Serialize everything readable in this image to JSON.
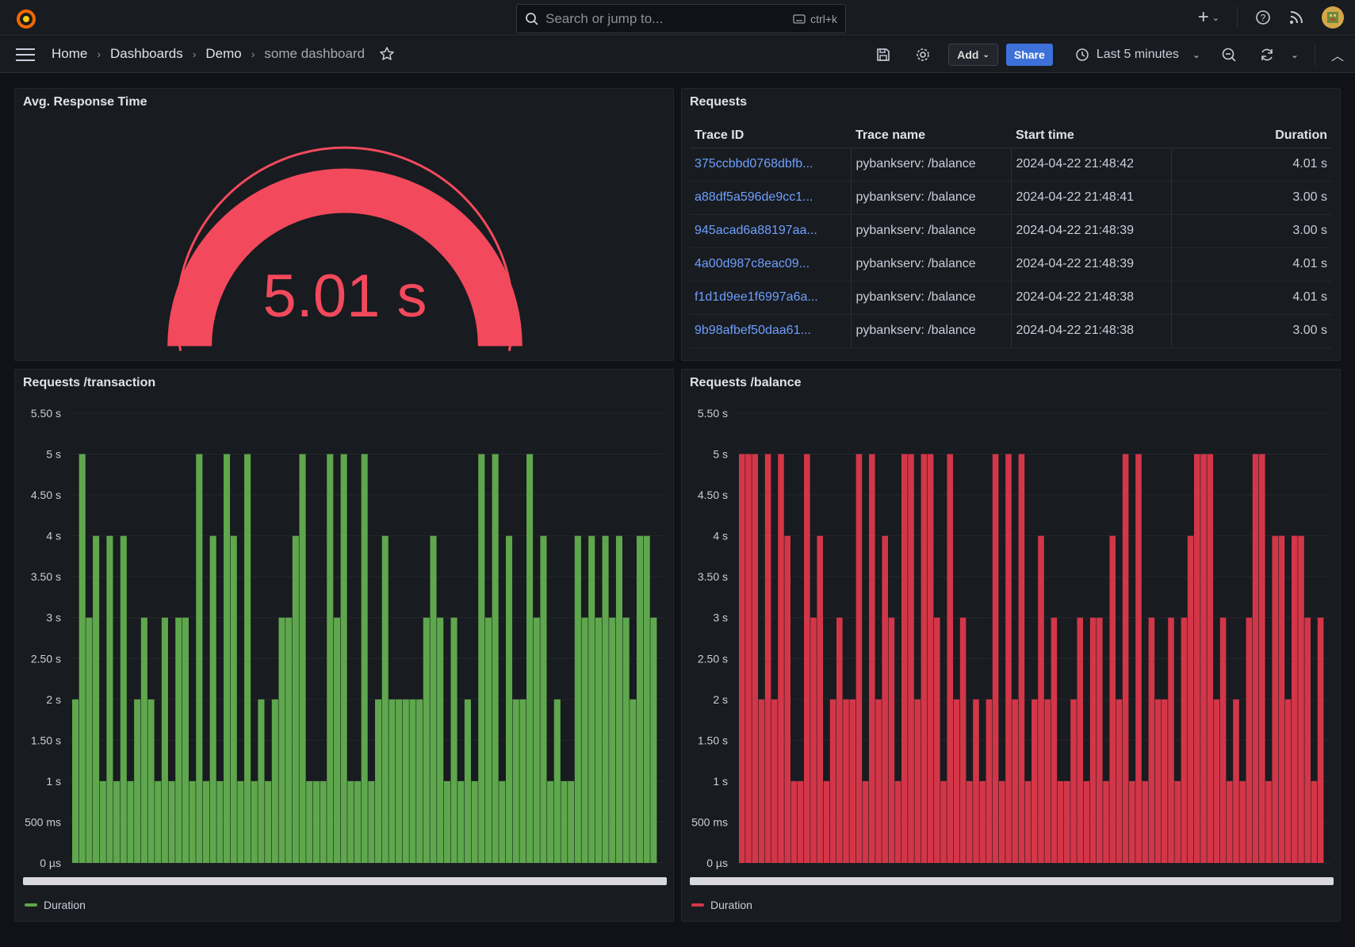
{
  "topbar": {
    "search_placeholder": "Search or jump to...",
    "search_shortcut": "ctrl+k",
    "icons": [
      "grafana-logo-icon",
      "plus-icon",
      "help-icon",
      "news-icon",
      "avatar"
    ]
  },
  "navbar": {
    "breadcrumbs": [
      "Home",
      "Dashboards",
      "Demo",
      "some dashboard"
    ],
    "add_label": "Add",
    "share_label": "Share",
    "time_range": "Last 5 minutes"
  },
  "colors": {
    "green": "#5fa74d",
    "red": "#d33648",
    "gauge": "#f2495c",
    "link": "#6e9fff",
    "share": "#3d71d9"
  },
  "gauge_panel": {
    "title": "Avg. Response Time",
    "value": "5.01 s"
  },
  "requests_panel": {
    "title": "Requests",
    "columns": [
      "Trace ID",
      "Trace name",
      "Start time",
      "Duration"
    ],
    "rows": [
      [
        "375ccbbd0768dbfb...",
        "pybankserv: /balance",
        "2024-04-22 21:48:42",
        "4.01 s"
      ],
      [
        "a88df5a596de9cc1...",
        "pybankserv: /balance",
        "2024-04-22 21:48:41",
        "3.00 s"
      ],
      [
        "945acad6a88197aa...",
        "pybankserv: /balance",
        "2024-04-22 21:48:39",
        "3.00 s"
      ],
      [
        "4a00d987c8eac09...",
        "pybankserv: /balance",
        "2024-04-22 21:48:39",
        "4.01 s"
      ],
      [
        "f1d1d9ee1f6997a6a...",
        "pybankserv: /balance",
        "2024-04-22 21:48:38",
        "4.01 s"
      ],
      [
        "9b98afbef50daa61...",
        "pybankserv: /balance",
        "2024-04-22 21:48:38",
        "3.00 s"
      ]
    ]
  },
  "chart_data": [
    {
      "type": "bar",
      "title": "Requests /transaction",
      "ylim": [
        0,
        5.5
      ],
      "yticks": [
        "0 µs",
        "500 ms",
        "1 s",
        "1.50 s",
        "2 s",
        "2.50 s",
        "3 s",
        "3.50 s",
        "4 s",
        "4.50 s",
        "5 s",
        "5.50 s"
      ],
      "series": [
        {
          "name": "Duration",
          "color": "#5fa74d",
          "values": [
            2,
            5,
            3,
            4,
            1,
            4,
            1,
            4,
            1,
            2,
            3,
            2,
            1,
            3,
            1,
            3,
            3,
            1,
            5,
            1,
            4,
            1,
            5,
            4,
            1,
            5,
            1,
            2,
            1,
            2,
            3,
            3,
            4,
            5,
            1,
            1,
            1,
            5,
            3,
            5,
            1,
            1,
            5,
            1,
            2,
            4,
            2,
            2,
            2,
            2,
            2,
            3,
            4,
            3,
            1,
            3,
            1,
            2,
            1,
            5,
            3,
            5,
            1,
            4,
            2,
            2,
            5,
            3,
            4,
            1,
            2,
            1,
            1,
            4,
            3,
            4,
            3,
            4,
            3,
            4,
            3,
            2,
            4,
            4,
            3
          ]
        }
      ],
      "legend": "bottom-left"
    },
    {
      "type": "bar",
      "title": "Requests /balance",
      "ylim": [
        0,
        5.5
      ],
      "yticks": [
        "0 µs",
        "500 ms",
        "1 s",
        "1.50 s",
        "2 s",
        "2.50 s",
        "3 s",
        "3.50 s",
        "4 s",
        "4.50 s",
        "5 s",
        "5.50 s"
      ],
      "series": [
        {
          "name": "Duration",
          "color": "#d33648",
          "values": [
            5,
            5,
            5,
            2,
            5,
            2,
            5,
            4,
            1,
            1,
            5,
            3,
            4,
            1,
            2,
            3,
            2,
            2,
            5,
            1,
            5,
            2,
            4,
            3,
            1,
            5,
            5,
            2,
            5,
            5,
            3,
            1,
            5,
            2,
            3,
            1,
            2,
            1,
            2,
            5,
            1,
            5,
            2,
            5,
            1,
            2,
            4,
            2,
            3,
            1,
            1,
            2,
            3,
            1,
            3,
            3,
            1,
            4,
            2,
            5,
            1,
            5,
            1,
            3,
            2,
            2,
            3,
            1,
            3,
            4,
            5,
            5,
            5,
            2,
            3,
            1,
            2,
            1,
            3,
            5,
            5,
            1,
            4,
            4,
            2,
            4,
            4,
            3,
            1,
            3
          ]
        }
      ],
      "legend": "bottom-left"
    }
  ]
}
